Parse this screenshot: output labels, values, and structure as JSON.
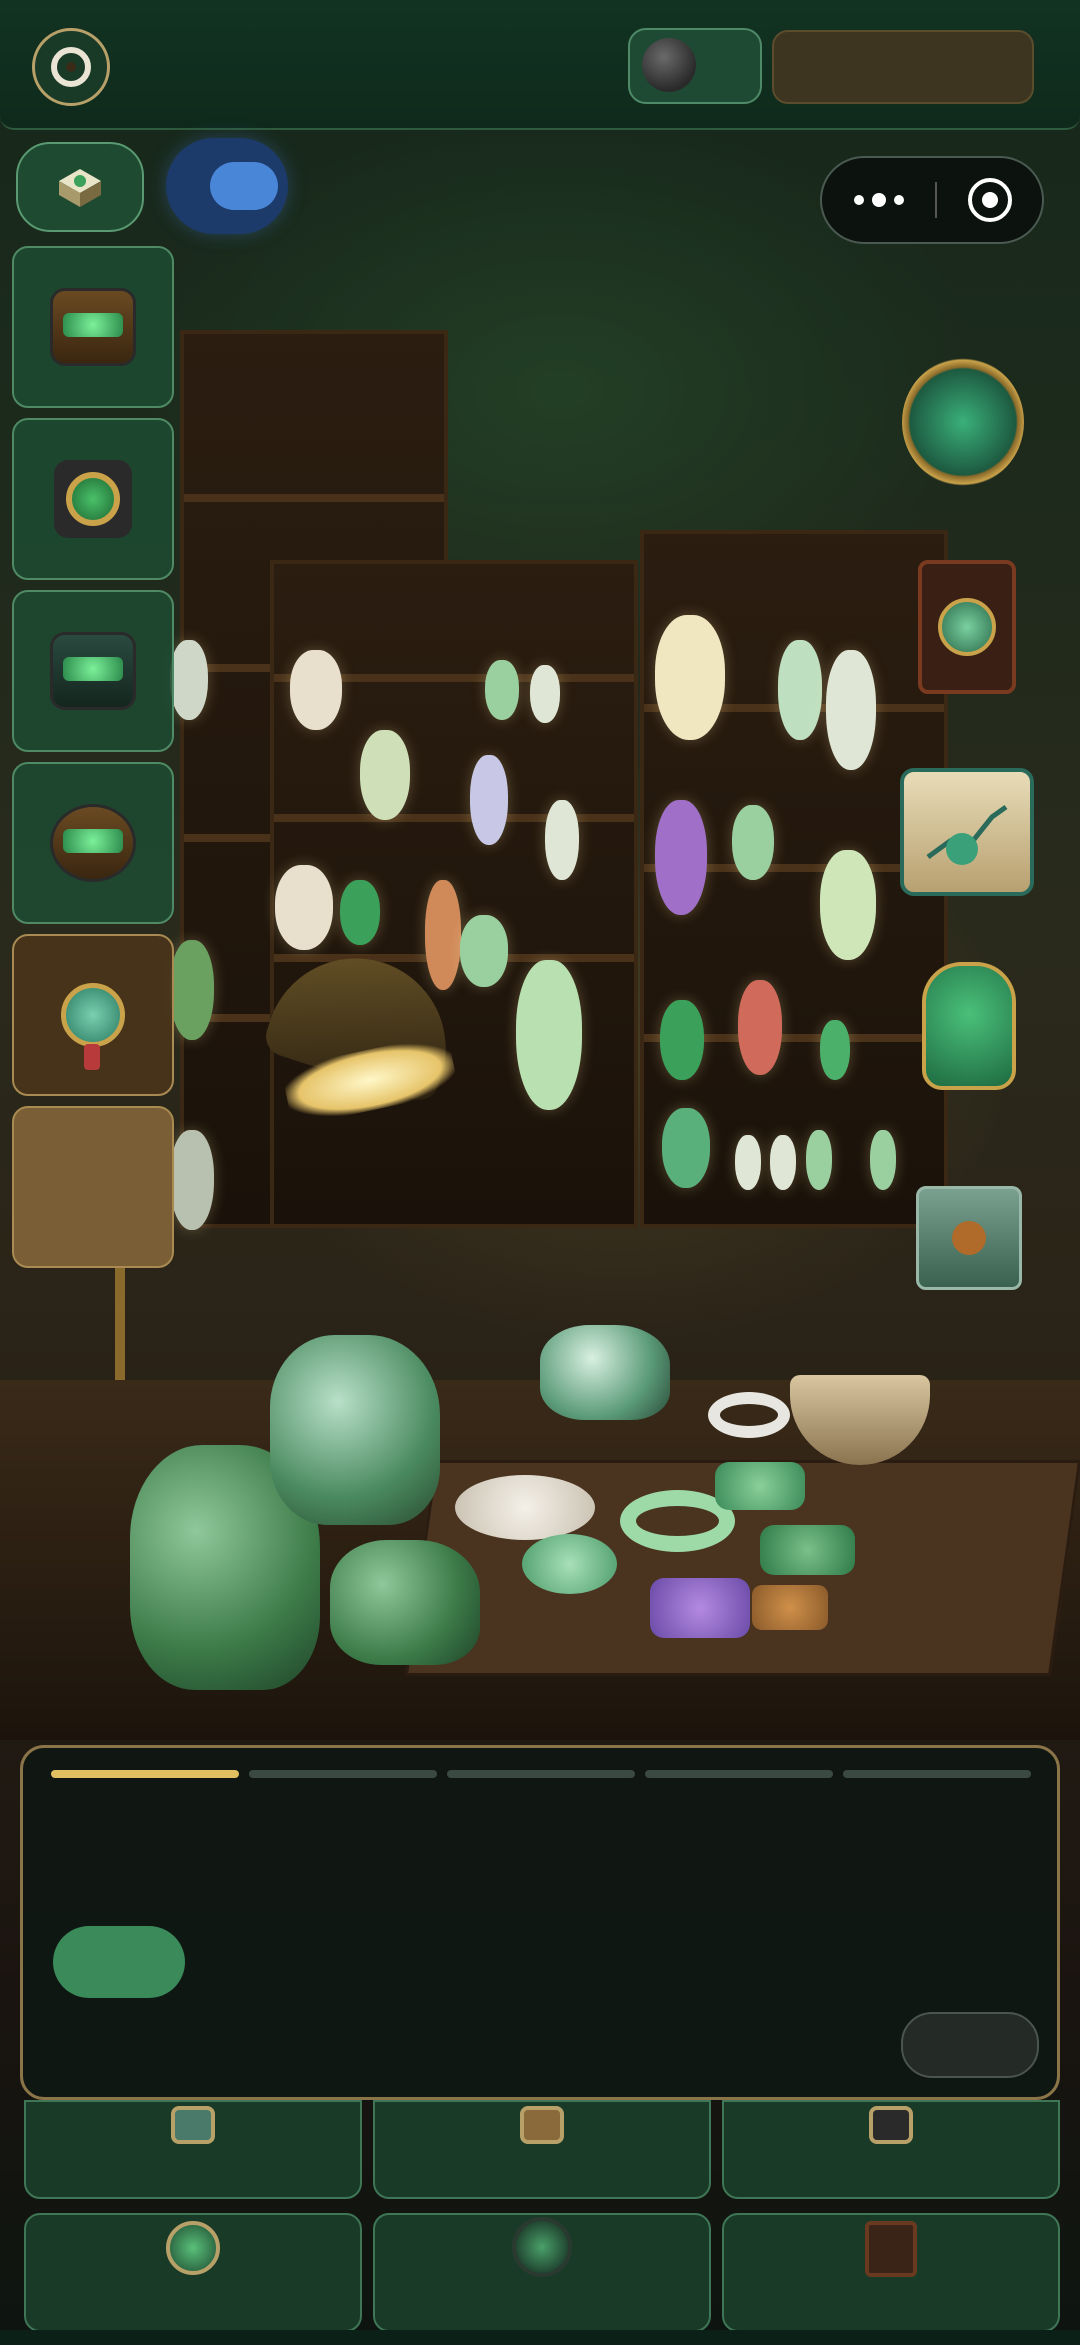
{
  "topbar": {
    "avatar_icon": "jade-ring-icon",
    "coin_icon": "stone-coin-icon",
    "currency_label": ""
  },
  "left_menu": {
    "items": [
      {
        "icon": "jade-chest-icon",
        "label": ""
      },
      {
        "icon": "jade-medallion-icon",
        "label": ""
      },
      {
        "icon": "treasure-box-icon",
        "label": ""
      },
      {
        "icon": "open-chest-icon",
        "label": ""
      },
      {
        "icon": "pendant-icon",
        "label": ""
      },
      {
        "icon": "empty-slot",
        "label": ""
      }
    ]
  },
  "right_menu": {
    "items": [
      {
        "icon": "trophy-icon"
      },
      {
        "icon": "jade-clock-icon"
      },
      {
        "icon": "market-scroll-icon"
      },
      {
        "icon": "dragon-pendant-icon"
      },
      {
        "icon": "envelope-icon"
      }
    ]
  },
  "dialog": {
    "progress_total": 5,
    "progress_current": 1,
    "text": "",
    "primary_label": "",
    "secondary_label": ""
  },
  "bottom_grid": {
    "cards": [
      {
        "icon": "jade-bangle-icon",
        "label": ""
      },
      {
        "icon": "figurine-icon",
        "label": ""
      },
      {
        "icon": "dark-stone-icon",
        "label": ""
      },
      {
        "icon": "jade-orb-icon",
        "label": ""
      },
      {
        "icon": "dark-medallion-icon",
        "label": ""
      },
      {
        "icon": "lantern-icon",
        "label": ""
      }
    ]
  },
  "colors": {
    "panel_border": "#8a7448",
    "progress_active": "#e0c060",
    "accent_green": "#3a8a5a",
    "card_bg": "#1a3a28"
  }
}
